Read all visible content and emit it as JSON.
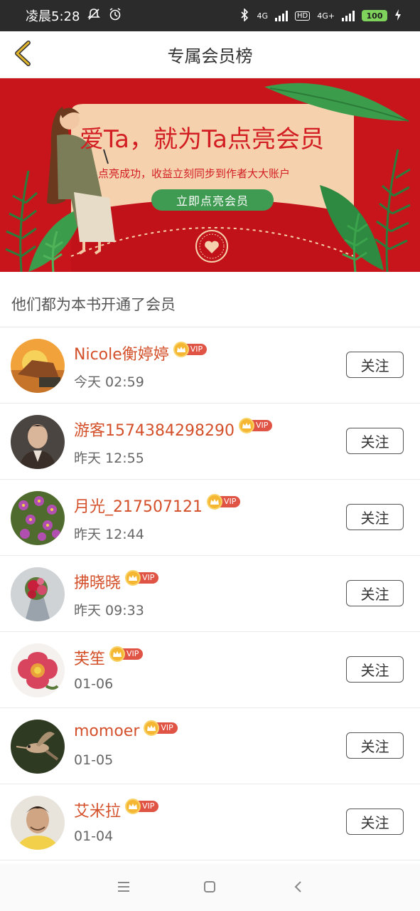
{
  "status_bar": {
    "time": "凌晨5:28",
    "network_1": "4G",
    "network_2": "4G+",
    "hd": "HD",
    "battery": "100"
  },
  "header": {
    "title": "专属会员榜"
  },
  "banner": {
    "headline": "爱Ta，就为Ta点亮会员",
    "subline": "点亮成功，收益立刻同步到作者大大账户",
    "cta": "立即点亮会员"
  },
  "section": {
    "title": "他们都为本书开通了会员"
  },
  "vip_label": "VIP",
  "members": [
    {
      "name": "Nicole衡婷婷",
      "time": "今天 02:59",
      "follow": "关注"
    },
    {
      "name": "游客1574384298290",
      "time": "昨天 12:55",
      "follow": "关注"
    },
    {
      "name": "月光_217507121",
      "time": "昨天 12:44",
      "follow": "关注"
    },
    {
      "name": "拂晓晓",
      "time": "昨天 09:33",
      "follow": "关注"
    },
    {
      "name": "芙笙",
      "time": "01-06",
      "follow": "关注"
    },
    {
      "name": "momoer",
      "time": "01-05",
      "follow": "关注"
    },
    {
      "name": "艾米拉",
      "time": "01-04",
      "follow": "关注"
    }
  ],
  "colors": {
    "accent_name": "#d4502a",
    "banner_red": "#c8141b",
    "cta_green": "#3f9a52",
    "back_arrow": "#e0b42b"
  },
  "icons": {
    "back": "chevron-left-icon",
    "menu": "menu-icon",
    "home": "home-square-icon",
    "nav_back": "nav-back-icon"
  }
}
